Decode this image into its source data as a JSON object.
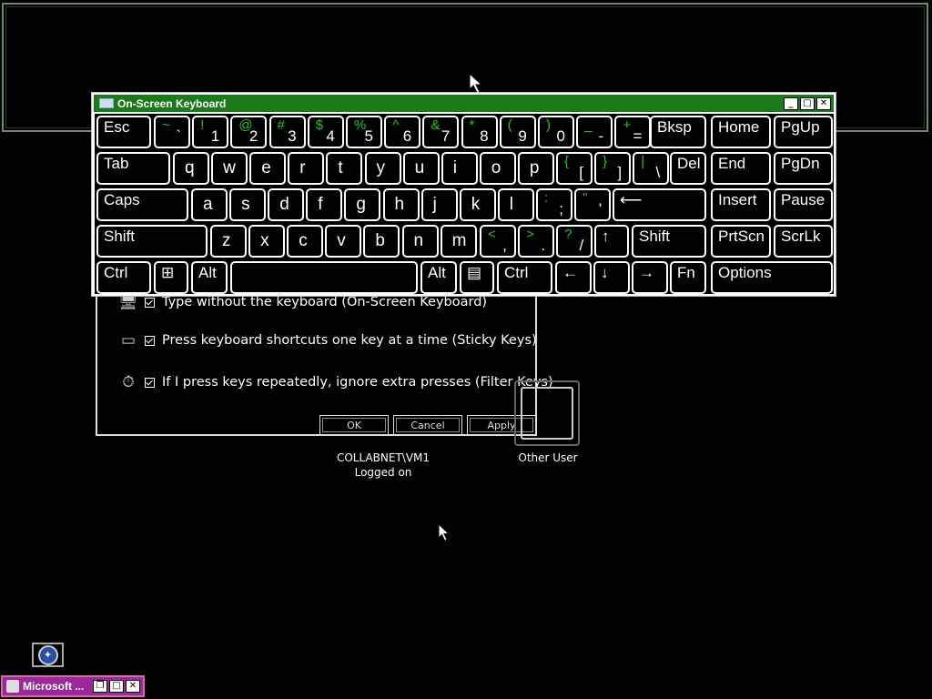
{
  "osk": {
    "title": "On-Screen Keyboard",
    "minimize": "_",
    "maximize": "□",
    "close": "✕",
    "keys": {
      "esc": "Esc",
      "tab": "Tab",
      "caps": "Caps",
      "shift": "Shift",
      "ctrl": "Ctrl",
      "alt": "Alt",
      "bksp": "Bksp",
      "del": "Del",
      "home": "Home",
      "pgup": "PgUp",
      "end": "End",
      "pgdn": "PgDn",
      "insert": "Insert",
      "pause": "Pause",
      "prtscn": "PrtScn",
      "scrlk": "ScrLk",
      "fn": "Fn",
      "options": "Options",
      "r1": [
        [
          "~",
          "`"
        ],
        [
          "!",
          "1"
        ],
        [
          "@",
          "2"
        ],
        [
          "#",
          "3"
        ],
        [
          "$",
          "4"
        ],
        [
          "%",
          "5"
        ],
        [
          "^",
          "6"
        ],
        [
          "&",
          "7"
        ],
        [
          "*",
          "8"
        ],
        [
          "(",
          "9"
        ],
        [
          ")",
          "0"
        ],
        [
          "_",
          "-"
        ],
        [
          "+",
          "="
        ]
      ],
      "r2": [
        "q",
        "w",
        "e",
        "r",
        "t",
        "y",
        "u",
        "i",
        "o",
        "p"
      ],
      "r2b": [
        [
          "{",
          "["
        ],
        [
          "}",
          "]"
        ],
        [
          "|",
          "\\"
        ]
      ],
      "r3": [
        "a",
        "s",
        "d",
        "f",
        "g",
        "h",
        "j",
        "k",
        "l"
      ],
      "r3b": [
        [
          ":",
          ";"
        ],
        [
          "\"",
          "'"
        ]
      ],
      "r4": [
        "z",
        "x",
        "c",
        "v",
        "b",
        "n",
        "m"
      ],
      "r4b": [
        [
          "<",
          ","
        ],
        [
          ">",
          "."
        ],
        [
          "?",
          "/"
        ]
      ],
      "up": "↑",
      "left": "←",
      "down": "↓",
      "right": "→",
      "enter": "⟵",
      "win": "⊞",
      "menu": "▤"
    }
  },
  "dialog": {
    "opt1": "Type without the keyboard (On-Screen Keyboard)",
    "opt2": "Press keyboard shortcuts one key at a time (Sticky Keys)",
    "opt3": "If I press keys repeatedly, ignore extra presses (Filter Keys)",
    "ok": "OK",
    "cancel": "Cancel",
    "apply": "Apply"
  },
  "users": {
    "u1_name": "COLLABNET\\VM1",
    "u1_status": "Logged on",
    "u2_name": "Other User"
  },
  "taskbar": {
    "button_label": "Microsoft ..."
  }
}
